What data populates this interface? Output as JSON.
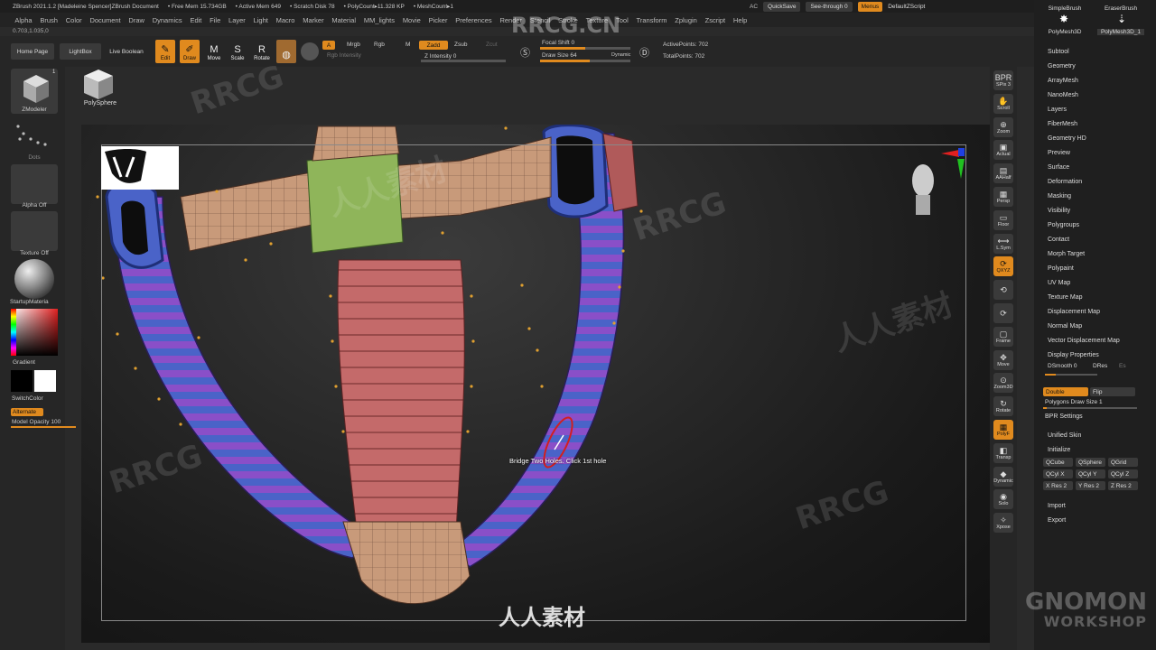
{
  "titlebar": {
    "app": "ZBrush 2021.1.2 [Madeleine Spencer]ZBrush Document",
    "free_mem": "• Free Mem 15.734GB",
    "active_mem": "• Active Mem 649",
    "scratch": "• Scratch Disk 78",
    "polycount": "• PolyCount▸11.328 KP",
    "meshcount": "• MeshCount▸1"
  },
  "quick": {
    "ac": "AC",
    "quicksave": "QuickSave",
    "seethrough": "See-through   0",
    "menus": "Menus",
    "script": "DefaultZScript"
  },
  "menus": [
    "Alpha",
    "Brush",
    "Color",
    "Document",
    "Draw",
    "Dynamics",
    "Edit",
    "File",
    "Layer",
    "Light",
    "Macro",
    "Marker",
    "Material",
    "MM_lights",
    "Movie",
    "Picker",
    "Preferences",
    "Render",
    "Stencil",
    "Stroke",
    "Texture",
    "Tool",
    "Transform",
    "Zplugin",
    "Zscript",
    "Help"
  ],
  "coord": "0.703,1.035,0",
  "toolbar": {
    "home": "Home Page",
    "lightbox": "LightBox",
    "live_boolean": "Live Boolean",
    "edit": "Edit",
    "draw": "Draw",
    "move": "Move",
    "scale": "Scale",
    "rotate": "Rotate",
    "a": "A",
    "mrgb": "Mrgb",
    "rgb": "Rgb",
    "m": "M",
    "zadd": "Zadd",
    "zsub": "Zsub",
    "zcut": "Zcut",
    "rgb_intensity": "Rgb Intensity",
    "z_intensity": "Z Intensity 0",
    "focal_shift": "Focal Shift 0",
    "draw_size": "Draw Size 64",
    "dynamic": "Dynamic",
    "active_points": "ActivePoints: 702",
    "total_points": "TotalPoints: 702",
    "z_intensity_fill": 0.0,
    "focal_fill": 0.5,
    "draw_size_fill": 0.55
  },
  "left": {
    "zmodeler": "ZModeler",
    "dots": "Dots",
    "alpha": "Alpha Off",
    "texture": "Texture Off",
    "material": "StartupMateria",
    "gradient": "Gradient",
    "switchcolor": "SwitchColor",
    "alternate": "Alternate",
    "opacity": "Model Opacity 100",
    "count": "1"
  },
  "polysphere": "PolySphere",
  "viewport": {
    "tooltip": "Bridge Two Holes. Click 1st hole"
  },
  "rightbar": [
    {
      "icon": "BPR",
      "label": "SPix 3"
    },
    {
      "icon": "✋",
      "label": "Scroll"
    },
    {
      "icon": "⊕",
      "label": "Zoom"
    },
    {
      "icon": "▣",
      "label": "Actual"
    },
    {
      "icon": "▤",
      "label": "AAHalf"
    },
    {
      "icon": "▦",
      "label": "Persp"
    },
    {
      "icon": "▭",
      "label": "Floor"
    },
    {
      "icon": "⟷",
      "label": "L.Sym"
    },
    {
      "icon": "⟳",
      "label": "QXYZ"
    },
    {
      "icon": "⟲",
      "label": ""
    },
    {
      "icon": "⟳",
      "label": ""
    },
    {
      "icon": "▢",
      "label": "Frame"
    },
    {
      "icon": "✥",
      "label": "Move"
    },
    {
      "icon": "⊙",
      "label": "Zoom3D"
    },
    {
      "icon": "↻",
      "label": "Rotate"
    },
    {
      "icon": "▦",
      "label": "PolyF"
    },
    {
      "icon": "◧",
      "label": "Transp"
    },
    {
      "icon": "◆",
      "label": "Dynamic"
    },
    {
      "icon": "◉",
      "label": "Solo"
    },
    {
      "icon": "✧",
      "label": "Xpose"
    }
  ],
  "palette": {
    "brush1": "SimpleBrush",
    "brush2": "EraserBrush",
    "brush3": "PolyMesh3D",
    "brush4": "PolyMesh3D_1",
    "items": [
      "Subtool",
      "Geometry",
      "ArrayMesh",
      "NanoMesh",
      "Layers",
      "FiberMesh",
      "Geometry HD",
      "Preview",
      "Surface",
      "Deformation",
      "Masking",
      "Visibility",
      "Polygroups",
      "Contact",
      "Morph Target",
      "Polypaint",
      "UV Map",
      "Texture Map",
      "Displacement Map",
      "Normal Map",
      "Vector Displacement Map",
      "Display Properties"
    ],
    "dsmooth": "DSmooth 0",
    "dres": "DRes",
    "es": "Es",
    "double": "Double",
    "flip": "Flip",
    "polygons_draw_size": "Polygons Draw Size 1",
    "bpr_settings": "BPR Settings",
    "unified_skin": "Unified Skin",
    "initialize": "Initialize",
    "init_row1": [
      "QCube",
      "QSphere",
      "QGrid"
    ],
    "init_row2": [
      "QCyl X",
      "QCyl Y",
      "QCyl Z"
    ],
    "init_row3": [
      "X Res 2",
      "Y Res 2",
      "Z Res 2"
    ],
    "import": "Import",
    "export": "Export"
  },
  "watermarks": {
    "top": "RRCG.CN",
    "center": "人人素材",
    "logo1": "GNOMON",
    "logo2": "WORKSHOP",
    "rrcg": "RRCG",
    "renren": "人人素材"
  },
  "colors": {
    "accent": "#e08a1e",
    "bg": "#262626",
    "purple": "#8a4fc8",
    "blue": "#4a63c8",
    "salmon": "#c46a6a",
    "tan": "#c89a7a",
    "green": "#8fb55a"
  }
}
